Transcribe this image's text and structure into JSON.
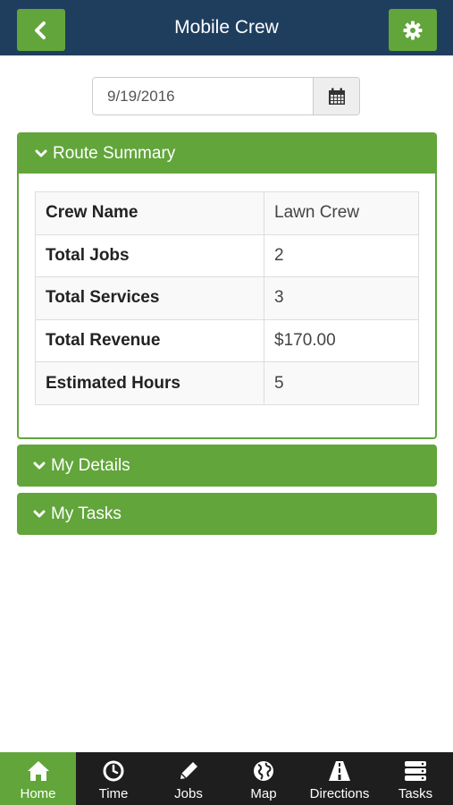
{
  "header": {
    "title": "Mobile Crew",
    "back_icon": "chevron-left-icon",
    "settings_icon": "gear-icon"
  },
  "date_picker": {
    "value": "9/19/2016",
    "icon": "calendar-icon"
  },
  "route_summary": {
    "title": "Route Summary",
    "rows": [
      {
        "label": "Crew Name",
        "value": "Lawn Crew"
      },
      {
        "label": "Total Jobs",
        "value": "2"
      },
      {
        "label": "Total Services",
        "value": "3"
      },
      {
        "label": "Total Revenue",
        "value": "$170.00"
      },
      {
        "label": "Estimated Hours",
        "value": "5"
      }
    ]
  },
  "panels": {
    "my_details": "My Details",
    "my_tasks": "My Tasks"
  },
  "bottom_nav": {
    "items": [
      {
        "label": "Home",
        "icon": "home-icon",
        "active": true
      },
      {
        "label": "Time",
        "icon": "clock-icon",
        "active": false
      },
      {
        "label": "Jobs",
        "icon": "pencil-icon",
        "active": false
      },
      {
        "label": "Map",
        "icon": "globe-icon",
        "active": false
      },
      {
        "label": "Directions",
        "icon": "road-icon",
        "active": false
      },
      {
        "label": "Tasks",
        "icon": "tasks-icon",
        "active": false
      }
    ]
  },
  "colors": {
    "header_bg": "#1f3e5e",
    "accent_green": "#62a53b",
    "nav_bg": "#1e1e1e"
  }
}
